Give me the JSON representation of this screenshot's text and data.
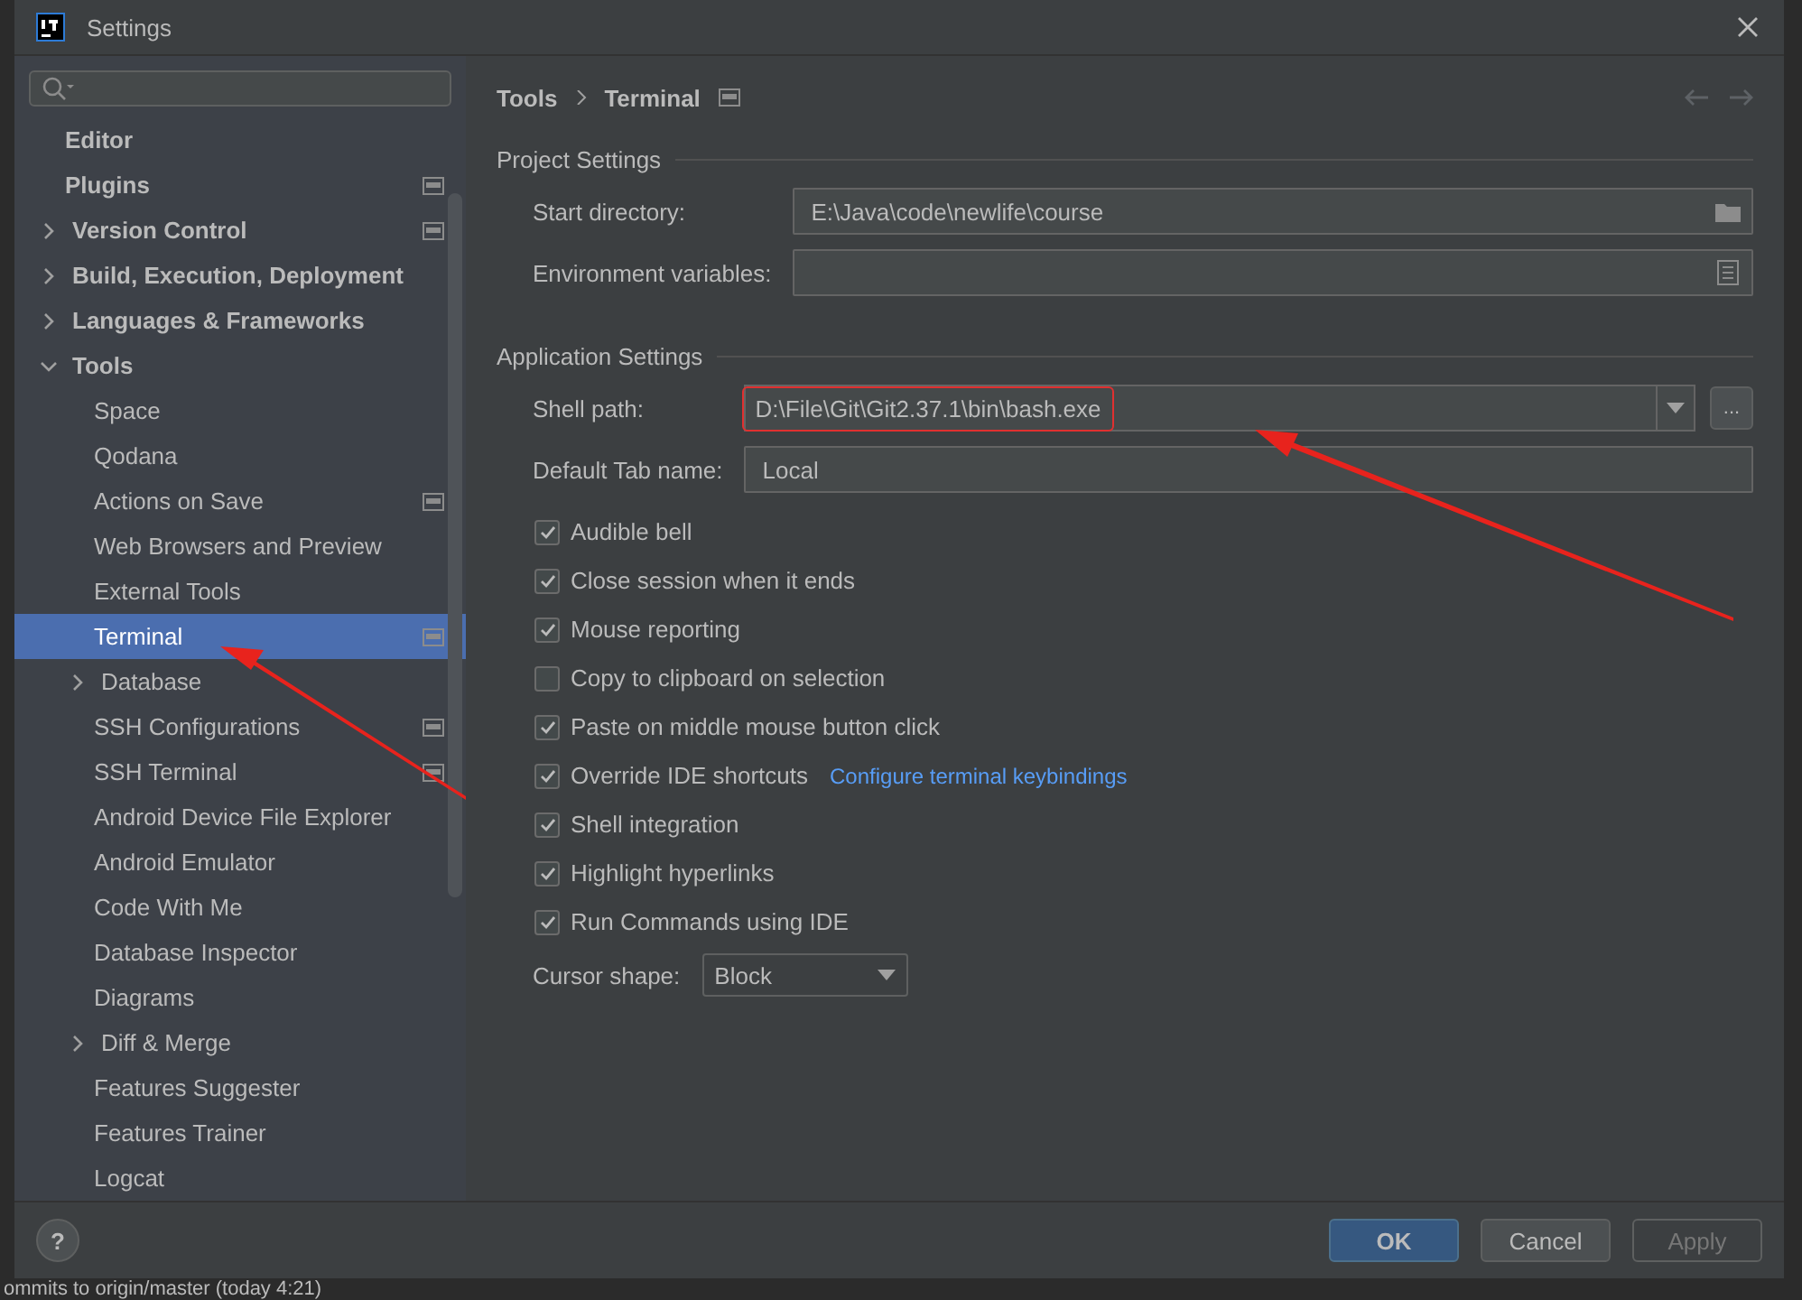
{
  "window": {
    "title": "Settings"
  },
  "sidebar": {
    "items": [
      {
        "label": "Editor",
        "selected": false,
        "project_level": false
      },
      {
        "label": "Plugins",
        "selected": false,
        "project_level": true
      },
      {
        "label": "Version Control",
        "selected": false,
        "project_level": true,
        "expanded": false
      },
      {
        "label": "Build, Execution, Deployment",
        "selected": false,
        "project_level": false,
        "expanded": false
      },
      {
        "label": "Languages & Frameworks",
        "selected": false,
        "project_level": false,
        "expanded": false
      },
      {
        "label": "Tools",
        "selected": false,
        "project_level": false,
        "expanded": true,
        "children": [
          {
            "label": "Space",
            "selected": false,
            "project_level": false
          },
          {
            "label": "Qodana",
            "selected": false,
            "project_level": false
          },
          {
            "label": "Actions on Save",
            "selected": false,
            "project_level": true
          },
          {
            "label": "Web Browsers and Preview",
            "selected": false,
            "project_level": false
          },
          {
            "label": "External Tools",
            "selected": false,
            "project_level": false
          },
          {
            "label": "Terminal",
            "selected": true,
            "project_level": true
          },
          {
            "label": "Database",
            "selected": false,
            "project_level": false,
            "expanded": false
          },
          {
            "label": "SSH Configurations",
            "selected": false,
            "project_level": true
          },
          {
            "label": "SSH Terminal",
            "selected": false,
            "project_level": true
          },
          {
            "label": "Android Device File Explorer",
            "selected": false,
            "project_level": false
          },
          {
            "label": "Android Emulator",
            "selected": false,
            "project_level": false
          },
          {
            "label": "Code With Me",
            "selected": false,
            "project_level": false
          },
          {
            "label": "Database Inspector",
            "selected": false,
            "project_level": false
          },
          {
            "label": "Diagrams",
            "selected": false,
            "project_level": false
          },
          {
            "label": "Diff & Merge",
            "selected": false,
            "project_level": false,
            "expanded": false
          },
          {
            "label": "Features Suggester",
            "selected": false,
            "project_level": false
          },
          {
            "label": "Features Trainer",
            "selected": false,
            "project_level": false
          },
          {
            "label": "Logcat",
            "selected": false,
            "project_level": false
          }
        ]
      }
    ]
  },
  "breadcrumb": {
    "items": [
      "Tools",
      "Terminal"
    ],
    "project_level": true
  },
  "sections": [
    {
      "title": "Project Settings",
      "fields": [
        {
          "label": "Start directory:",
          "kind": "folder",
          "value": "E:\\Java\\code\\newlife\\course"
        },
        {
          "label": "Environment variables:",
          "kind": "list"
        }
      ]
    },
    {
      "title": "Application Settings",
      "fields": [
        {
          "label": "Shell path:",
          "kind": "combo",
          "value": "D:\\File\\Git\\Git2.37.1\\bin\\bash.exe",
          "browse_label": "...",
          "highlighted": true
        },
        {
          "label": "Default Tab name:",
          "kind": "text",
          "value": "Local"
        }
      ]
    }
  ],
  "checkboxes": [
    {
      "label": "Audible bell",
      "checked": true
    },
    {
      "label": "Close session when it ends",
      "checked": true
    },
    {
      "label": "Mouse reporting",
      "checked": true
    },
    {
      "label": "Copy to clipboard on selection",
      "checked": false
    },
    {
      "label": "Paste on middle mouse button click",
      "checked": true
    },
    {
      "label": "Override IDE shortcuts",
      "checked": true,
      "link": "Configure terminal keybindings"
    },
    {
      "label": "Shell integration",
      "checked": true
    },
    {
      "label": "Highlight hyperlinks",
      "checked": true
    },
    {
      "label": "Run Commands using IDE",
      "checked": true
    }
  ],
  "cursor_shape": {
    "label": "Cursor shape:",
    "value": "Block"
  },
  "help_button": "?",
  "buttons": [
    {
      "label": "OK",
      "kind": "primary"
    },
    {
      "label": "Cancel",
      "kind": "normal"
    },
    {
      "label": "Apply",
      "kind": "disabled"
    }
  ],
  "status_bar": {
    "text": "ommits to origin/master (today 4:21)"
  }
}
